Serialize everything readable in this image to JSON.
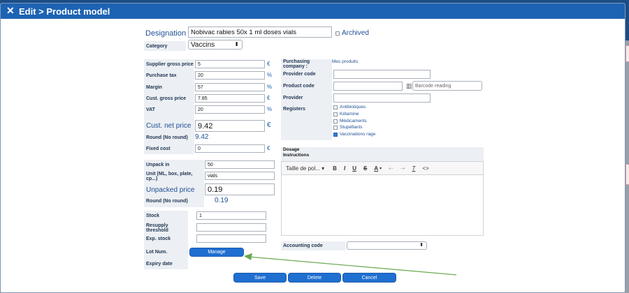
{
  "dialog": {
    "title": "Edit > Product model",
    "close_icon": "close-icon"
  },
  "designation": {
    "label": "Designation",
    "value": "Nobivac rabies 50x 1 ml doses vials",
    "archived_label": "Archived"
  },
  "category": {
    "label": "Category",
    "value": "Vaccins"
  },
  "pricing": {
    "supplier_gross_price": {
      "label": "Supplier gross price",
      "value": "5",
      "unit": "€"
    },
    "purchase_tax": {
      "label": "Purchase tax",
      "value": "20",
      "unit": "%"
    },
    "margin": {
      "label": "Margin",
      "value": "57",
      "unit": "%"
    },
    "cust_gross_price": {
      "label": "Cust. gross price",
      "value": "7.85",
      "unit": "€"
    },
    "vat": {
      "label": "VAT",
      "value": "20",
      "unit": "%"
    },
    "cust_net_price": {
      "label": "Cust. net price",
      "value": "9.42",
      "unit": "€"
    },
    "round": {
      "label": "Round (No round)",
      "value": "9.42"
    },
    "fixed_cost": {
      "label": "Fixed cost",
      "value": "0",
      "unit": "€"
    }
  },
  "unpack": {
    "unpack_in": {
      "label": "Unpack in",
      "value": "50"
    },
    "unit": {
      "label": "Unit (ML, box, plate, cp...)",
      "value": "vials"
    },
    "unpacked_price": {
      "label": "Unpacked price",
      "value": "0.19"
    },
    "round": {
      "label": "Round (No round)",
      "value": "0.19"
    }
  },
  "stock": {
    "stock": {
      "label": "Stock",
      "value": "1"
    },
    "resupply_threshold": {
      "label": "Resupply threshold",
      "value": ""
    },
    "exp_stock": {
      "label": "Exp. stock",
      "value": ""
    },
    "lot_num": {
      "label": "Lot Num.",
      "manage_label": "Manage"
    },
    "expiry_date": {
      "label": "Expiry date"
    }
  },
  "purchasing": {
    "company_label": "Purchasing company :",
    "company_value": "Mes produits",
    "provider_code_label": "Provider code",
    "product_code_label": "Product code",
    "barcode_placeholder": "Barcode reading",
    "provider_label": "Provider",
    "registers_label": "Registers",
    "registers": [
      {
        "label": "Antibiotiques",
        "checked": false
      },
      {
        "label": "Kétamine",
        "checked": false
      },
      {
        "label": "Médicaments",
        "checked": false
      },
      {
        "label": "Stupéfiants",
        "checked": false
      },
      {
        "label": "Vaccinations rage",
        "checked": true
      }
    ]
  },
  "dosage": {
    "label_line1": "Dosage",
    "label_line2": "Instructions",
    "font_size_label": "Taille de pol...",
    "toolbar_icons": [
      "bold-icon",
      "italic-icon",
      "underline-icon",
      "strikethrough-icon",
      "text-color-icon",
      "undo-icon",
      "redo-icon",
      "clear-format-icon",
      "source-code-icon"
    ]
  },
  "accounting": {
    "label": "Accounting code",
    "value": ""
  },
  "actions": {
    "save": "Save",
    "delete": "Delete",
    "cancel": "Cancel"
  },
  "colors": {
    "titlebar": "#1d63b3",
    "button": "#1f6fd1",
    "label_bg": "#eceff3",
    "annotation_arrow": "#6aa84f"
  }
}
